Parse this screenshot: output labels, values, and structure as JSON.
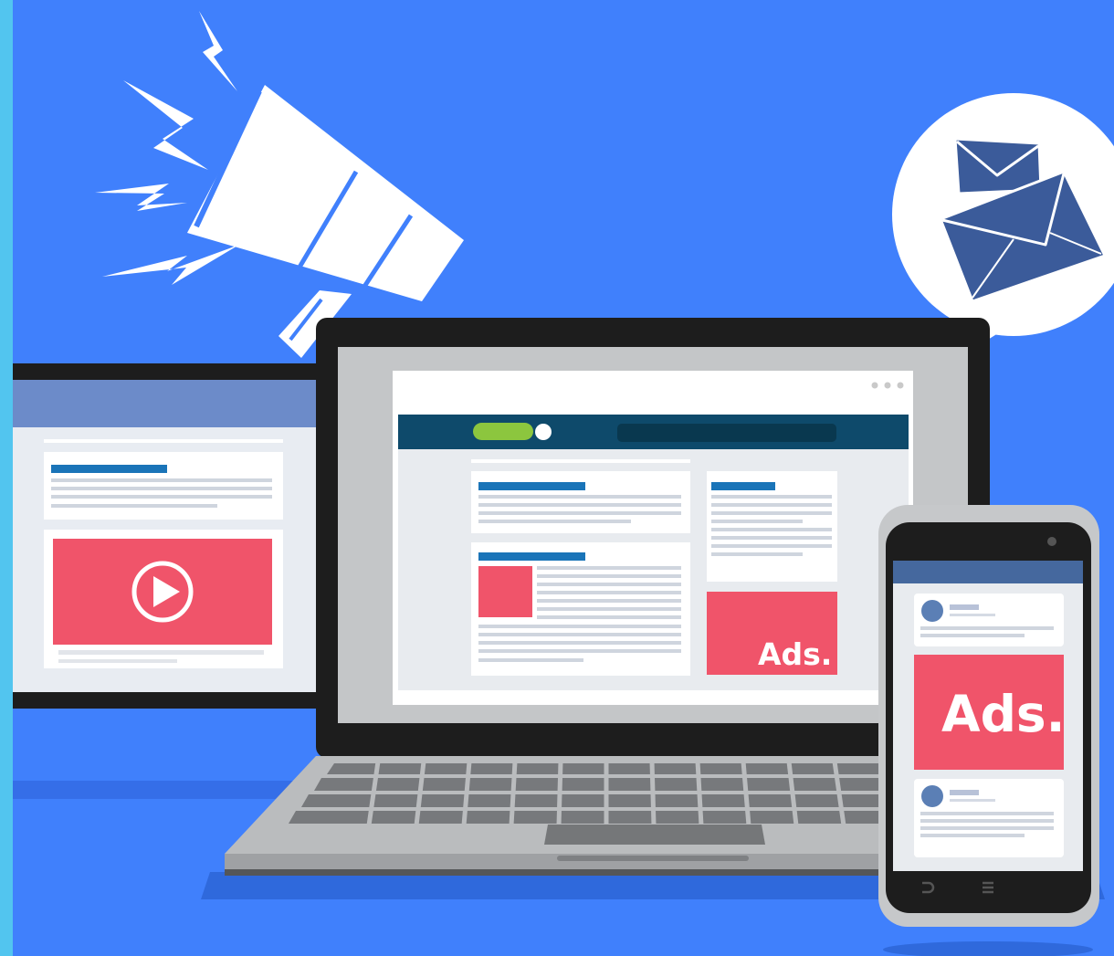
{
  "laptop_ad": {
    "label": "Ads."
  },
  "phone_ad": {
    "label": "Ads."
  },
  "icons": [
    "megaphone-icon",
    "envelope-icon",
    "play-icon"
  ],
  "colors": {
    "background": "#4080fc",
    "left_strip": "#52c5ef",
    "ad_red": "#f0546a",
    "header_navy": "#0e4a6b",
    "accent_green": "#8cc63e",
    "envelope_blue": "#3b5b9a",
    "monitor_header": "#6c8bc9",
    "text_line_blue": "#1a74b8"
  }
}
